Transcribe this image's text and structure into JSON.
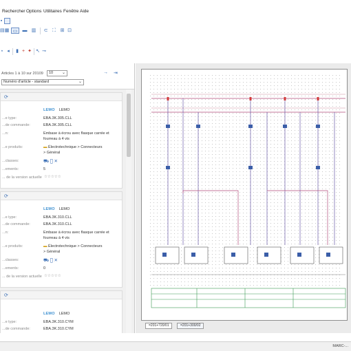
{
  "menu": {
    "items": [
      "Rechercher",
      "Options",
      "Utilitaires",
      "Fenêtre",
      "Aide"
    ]
  },
  "toolbar": {
    "icons": [
      "window-icon",
      "layout-icon",
      "grid-icon",
      "list-icon",
      "split-icon",
      "table-icon",
      "connect-icon",
      "expand-icon",
      "tree-icon"
    ]
  },
  "left_panel": {
    "filter_label": "Articles 1 à 10 sur 20109",
    "page_size": "10",
    "sort_select": "Numéro d'article - standard",
    "cards": [
      {
        "manufacturer_logo": "LEMO",
        "manufacturer": "LEMO",
        "type_label": "...e type:",
        "type": "EBA.3K.305.CLL",
        "order_label": "...de commande:",
        "order": "EBA.3K.305.CLL",
        "desc_label": "...n:",
        "desc_line1": "Embase à écrou avec flasque carrée et",
        "desc_line2": "fourreau à 4 vis",
        "group_label": "...e produits:",
        "group_line1": "Électrotechnique > Connecteurs",
        "group_line2": "> Général",
        "links_label": "...classes:",
        "count_label": "...ements:",
        "count": "5",
        "version_label": "... de la version actuelle"
      },
      {
        "manufacturer_logo": "LEMO",
        "manufacturer": "LEMO",
        "type_label": "...e type:",
        "type": "EBA.3K.310.CLL",
        "order_label": "...de commande:",
        "order": "EBA.3K.310.CLL",
        "desc_label": "...n:",
        "desc_line1": "Embase à écrou avec flasque carrée et",
        "desc_line2": "fourreau à 4 vis",
        "group_label": "...e produits:",
        "group_line1": "Électrotechnique > Connecteurs",
        "group_line2": "> Général",
        "links_label": "...classes:",
        "count_label": "...ements:",
        "count": "0",
        "version_label": "... de la version actuelle"
      },
      {
        "manufacturer_logo": "LEMO",
        "manufacturer": "LEMO",
        "type_label": "...e type:",
        "type": "EBA.3K.310.CYM",
        "order_label": "...de commande:",
        "order": "EBA.3K.310.CYM"
      }
    ]
  },
  "sheet_tabs": [
    "=201+?20/01",
    "=201+300/02"
  ],
  "status": "MARC-..."
}
